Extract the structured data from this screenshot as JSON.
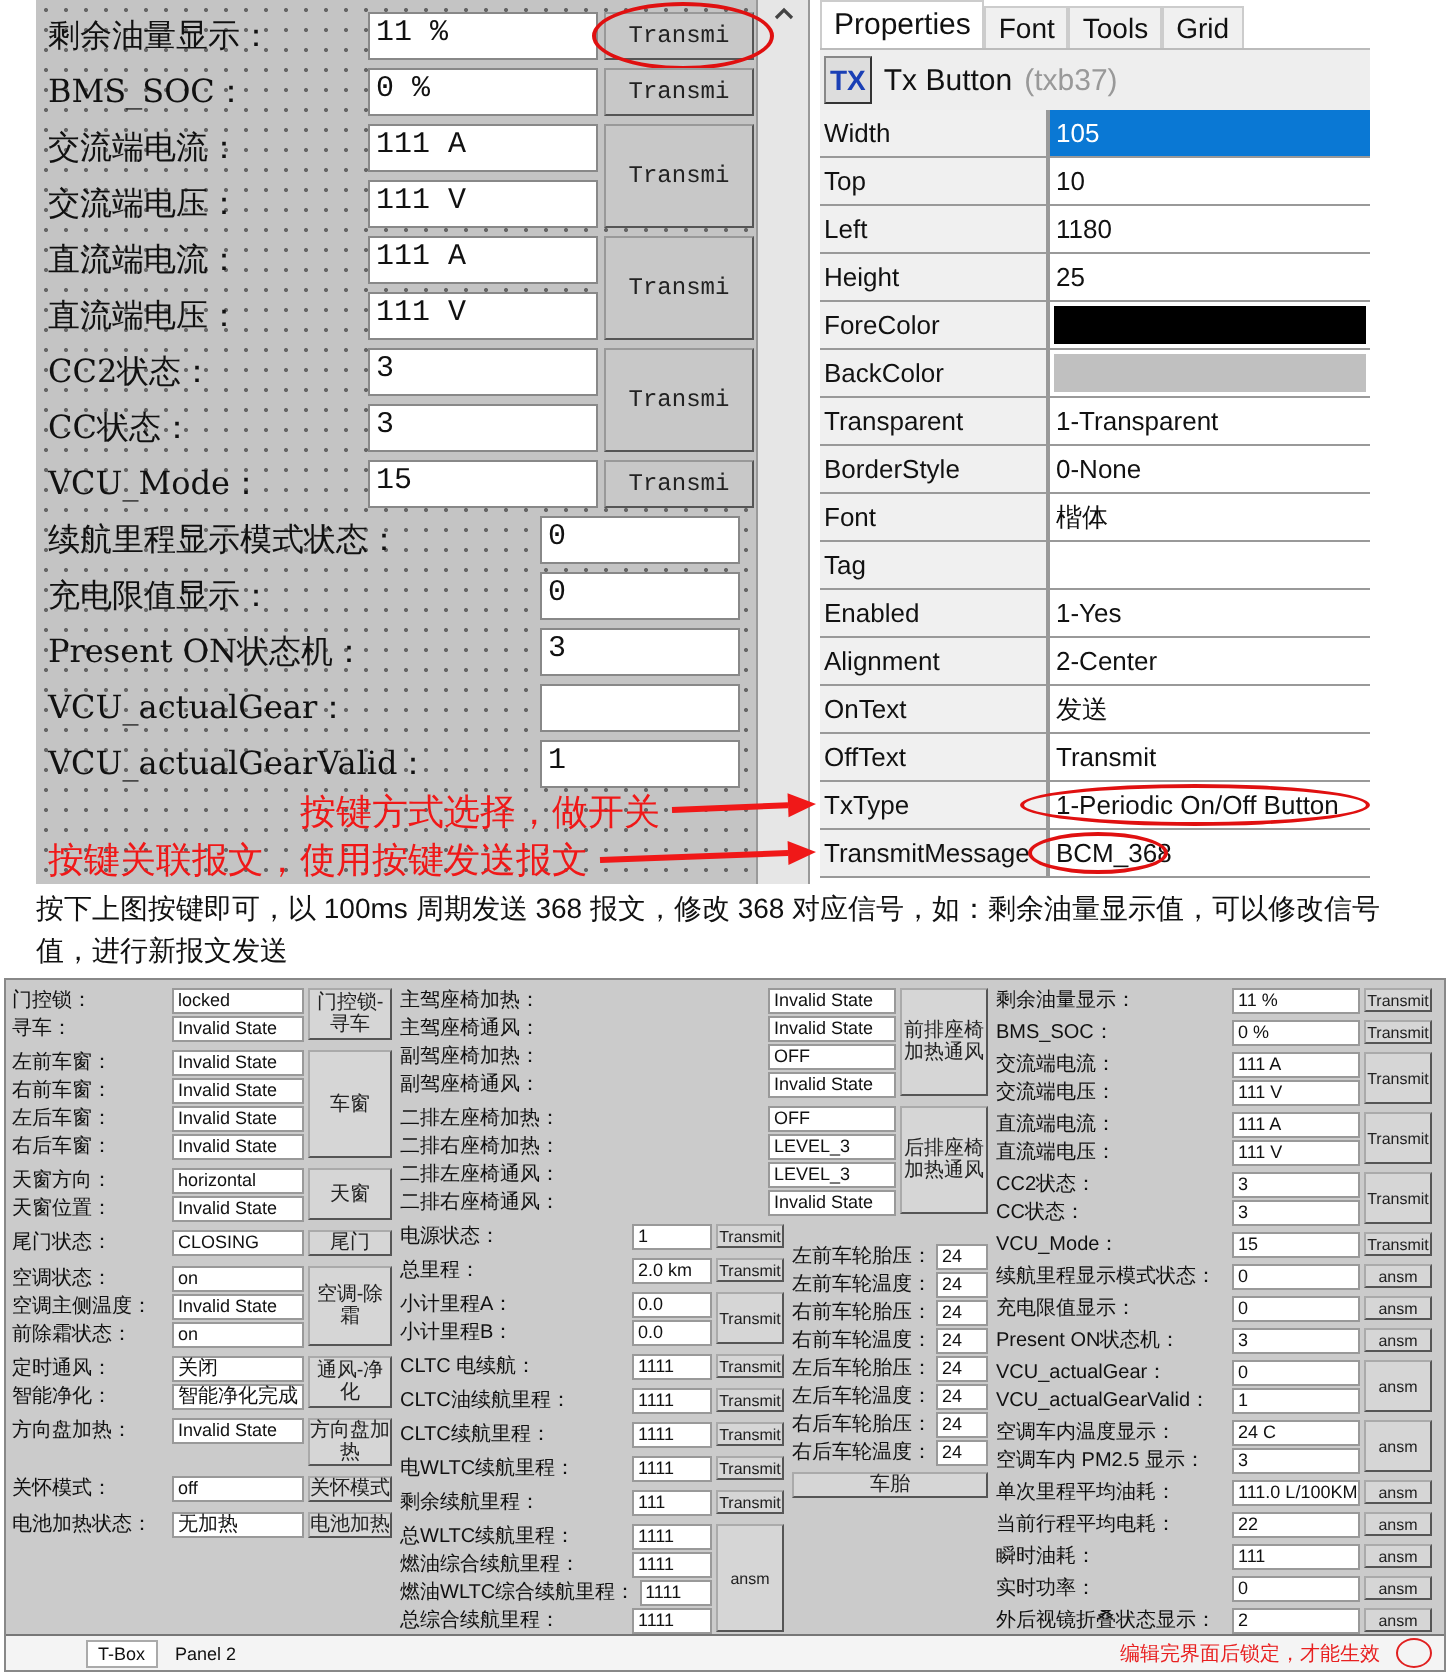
{
  "canvas": {
    "groups": [
      {
        "kind": "button_group",
        "fields": [
          {
            "label": "剩余油量显示：",
            "value": "11 %"
          }
        ],
        "button": "Transmi",
        "circled": true
      },
      {
        "kind": "button_group",
        "fields": [
          {
            "label": "BMS_SOC：",
            "value": "0 %"
          }
        ],
        "button": "Transmi",
        "circled": false
      },
      {
        "kind": "button_group",
        "fields": [
          {
            "label": "交流端电流：",
            "value": "111 A"
          },
          {
            "label": "交流端电压：",
            "value": "111 V"
          }
        ],
        "button": "Transmi",
        "circled": false
      },
      {
        "kind": "button_group",
        "fields": [
          {
            "label": "直流端电流：",
            "value": "111 A"
          },
          {
            "label": "直流端电压：",
            "value": "111 V"
          }
        ],
        "button": "Transmi",
        "circled": false
      },
      {
        "kind": "button_group",
        "fields": [
          {
            "label": "CC2状态：",
            "value": "3"
          },
          {
            "label": "CC状态：",
            "value": "3"
          }
        ],
        "button": "Transmi",
        "circled": false
      },
      {
        "kind": "button_group",
        "fields": [
          {
            "label": "VCU_Mode：",
            "value": "15"
          }
        ],
        "button": "Transmi",
        "circled": false
      },
      {
        "kind": "plain",
        "fields": [
          {
            "label": "续航里程显示模式状态：",
            "value": "0"
          },
          {
            "label": "充电限值显示：",
            "value": "0"
          },
          {
            "label": "Present ON状态机：",
            "value": "3"
          },
          {
            "label": "VCU_actualGear："
          },
          {
            "label": "VCU_actualGearValid：",
            "value": "1"
          }
        ]
      }
    ]
  },
  "annotations": [
    {
      "text": "按键方式选择，做开关"
    },
    {
      "text": "按键关联报文，使用按键发送报文"
    }
  ],
  "properties": {
    "tabs": [
      {
        "label": "Properties",
        "selected": true
      },
      {
        "label": "Font",
        "selected": false
      },
      {
        "label": "Tools",
        "selected": false
      },
      {
        "label": "Grid",
        "selected": false
      }
    ],
    "header": {
      "icon_text": "TX",
      "title": "Tx Button",
      "id": "(txb37)"
    },
    "rows": [
      {
        "kind": "text",
        "name": "Width",
        "value": "105",
        "selected": true,
        "circled": false
      },
      {
        "kind": "text",
        "name": "Top",
        "value": "10",
        "selected": false,
        "circled": false
      },
      {
        "kind": "text",
        "name": "Left",
        "value": "1180",
        "selected": false,
        "circled": false
      },
      {
        "kind": "text",
        "name": "Height",
        "value": "25",
        "selected": false,
        "circled": false
      },
      {
        "kind": "color",
        "name": "ForeColor",
        "color": "#000000",
        "selected": false,
        "circled": false
      },
      {
        "kind": "color",
        "name": "BackColor",
        "color": "#c0c0c0",
        "selected": false,
        "circled": false
      },
      {
        "kind": "text",
        "name": "Transparent",
        "value": "1-Transparent",
        "selected": false,
        "circled": false
      },
      {
        "kind": "text",
        "name": "BorderStyle",
        "value": "0-None",
        "selected": false,
        "circled": false
      },
      {
        "kind": "text",
        "name": "Font",
        "value": "楷体",
        "selected": false,
        "circled": false
      },
      {
        "kind": "text",
        "name": "Tag",
        "selected": false,
        "circled": false
      },
      {
        "kind": "text",
        "name": "Enabled",
        "value": "1-Yes",
        "selected": false,
        "circled": false
      },
      {
        "kind": "text",
        "name": "Alignment",
        "value": "2-Center",
        "selected": false,
        "circled": false
      },
      {
        "kind": "text",
        "name": "OnText",
        "value": "发送",
        "selected": false,
        "circled": false
      },
      {
        "kind": "text",
        "name": "OffText",
        "value": "Transmit",
        "selected": false,
        "circled": false
      },
      {
        "kind": "text",
        "name": "TxType",
        "value": "1-Periodic On/Off Button",
        "selected": false,
        "circled": true
      },
      {
        "kind": "text",
        "name": "TransmitMessage",
        "value": "BCM_368",
        "selected": false,
        "circled": true
      }
    ]
  },
  "paragraph": "按下上图按键即可，以 100ms 周期发送 368 报文，修改 368 对应信号，如：剩余油量显示值，可以修改信号值，进行新报文发送",
  "app_panel": {
    "left_groups": [
      {
        "kind": "side",
        "fields": [
          {
            "label": "门控锁：",
            "value": "locked"
          },
          {
            "label": "寻车：",
            "value": "Invalid State"
          }
        ],
        "button": "门控锁-寻车"
      },
      {
        "kind": "side",
        "fields": [
          {
            "label": "左前车窗：",
            "value": "Invalid State"
          },
          {
            "label": "右前车窗：",
            "value": "Invalid State"
          },
          {
            "label": "左后车窗：",
            "value": "Invalid State"
          },
          {
            "label": "右后车窗：",
            "value": "Invalid State"
          }
        ],
        "button": "车窗"
      },
      {
        "kind": "side",
        "fields": [
          {
            "label": "天窗方向：",
            "value": "horizontal"
          },
          {
            "label": "天窗位置：",
            "value": "Invalid State"
          }
        ],
        "button": "天窗"
      },
      {
        "kind": "side",
        "fields": [
          {
            "label": "尾门状态：",
            "value": "CLOSING"
          }
        ],
        "button": "尾门"
      },
      {
        "kind": "side",
        "fields": [
          {
            "label": "空调状态：",
            "value": "on"
          },
          {
            "label": "空调主侧温度：",
            "value": "Invalid State"
          },
          {
            "label": "前除霜状态：",
            "value": "on"
          }
        ],
        "button": "空调-除霜"
      },
      {
        "kind": "side",
        "fields": [
          {
            "label": "定时通风：",
            "value": "关闭"
          },
          {
            "label": "智能净化：",
            "value": "智能净化完成"
          }
        ],
        "button": "通风-净化"
      },
      {
        "kind": "side",
        "fields": [
          {
            "label": "方向盘加热：",
            "value": "Invalid State"
          }
        ],
        "button": "方向盘加热"
      },
      {
        "kind": "side",
        "fields": [
          {
            "label": "关怀模式：",
            "value": "off"
          }
        ],
        "button": "关怀模式"
      },
      {
        "kind": "side",
        "fields": [
          {
            "label": "电池加热状态：",
            "value": "无加热"
          }
        ],
        "button": "电池加热"
      }
    ],
    "seat_groups": [
      {
        "kind": "side",
        "fields": [
          {
            "label": "主驾座椅加热：",
            "value": "Invalid State"
          },
          {
            "label": "主驾座椅通风：",
            "value": "Invalid State"
          },
          {
            "label": "副驾座椅加热：",
            "value": "OFF"
          },
          {
            "label": "副驾座椅通风：",
            "value": "Invalid State"
          }
        ],
        "button": "前排座椅加热通风"
      },
      {
        "kind": "side",
        "fields": [
          {
            "label": "二排左座椅加热：",
            "value": "OFF"
          },
          {
            "label": "二排右座椅加热：",
            "value": "LEVEL_3"
          },
          {
            "label": "二排左座椅通风：",
            "value": "LEVEL_3"
          },
          {
            "label": "二排右座椅通风：",
            "value": "Invalid State"
          }
        ],
        "button": "后排座椅加热通风"
      }
    ],
    "value_groups": [
      {
        "kind": "side",
        "fields": [
          {
            "label": "电源状态：",
            "value": "1"
          }
        ],
        "button": "Transmit"
      },
      {
        "kind": "side",
        "fields": [
          {
            "label": "总里程：",
            "value": "2.0 km"
          }
        ],
        "button": "Transmit"
      },
      {
        "kind": "side",
        "fields": [
          {
            "label": "小计里程A：",
            "value": "0.0"
          },
          {
            "label": "小计里程B：",
            "value": "0.0"
          }
        ],
        "button": "Transmit"
      },
      {
        "kind": "side",
        "fields": [
          {
            "label": "CLTC 电续航：",
            "value": "1111"
          }
        ],
        "button": "Transmit"
      },
      {
        "kind": "side",
        "fields": [
          {
            "label": "CLTC油续航里程：",
            "value": "1111"
          }
        ],
        "button": "Transmit"
      },
      {
        "kind": "side",
        "fields": [
          {
            "label": "CLTC续航里程：",
            "value": "1111"
          }
        ],
        "button": "Transmit"
      },
      {
        "kind": "side",
        "fields": [
          {
            "label": "电WLTC续航里程：",
            "value": "1111"
          }
        ],
        "button": "Transmit"
      },
      {
        "kind": "side",
        "fields": [
          {
            "label": "剩余续航里程：",
            "value": "111"
          }
        ],
        "button": "Transmit"
      },
      {
        "kind": "side",
        "fields": [
          {
            "label": "总WLTC续航里程：",
            "value": "1111"
          },
          {
            "label": "燃油综合续航里程：",
            "value": "1111"
          },
          {
            "label": "燃油WLTC综合续航里程：",
            "value": "1111"
          },
          {
            "label": "总综合续航里程：",
            "value": "1111"
          }
        ],
        "button": "ansm"
      }
    ],
    "tire_group": {
      "kind": "stacked",
      "fields": [
        {
          "label": "左前车轮胎压：",
          "value": "24"
        },
        {
          "label": "左前车轮温度：",
          "value": "24"
        },
        {
          "label": "右前车轮胎压：",
          "value": "24"
        },
        {
          "label": "右前车轮温度：",
          "value": "24"
        },
        {
          "label": "左后车轮胎压：",
          "value": "24"
        },
        {
          "label": "左后车轮温度：",
          "value": "24"
        },
        {
          "label": "右后车轮胎压：",
          "value": "24"
        },
        {
          "label": "右后车轮温度：",
          "value": "24"
        }
      ],
      "button": "车胎"
    },
    "right_groups": [
      {
        "kind": "side",
        "fields": [
          {
            "label": "剩余油量显示：",
            "value": "11 %"
          }
        ],
        "button": "Transmit"
      },
      {
        "kind": "side",
        "fields": [
          {
            "label": "BMS_SOC：",
            "value": "0 %"
          }
        ],
        "button": "Transmit"
      },
      {
        "kind": "side",
        "fields": [
          {
            "label": "交流端电流：",
            "value": "111 A"
          },
          {
            "label": "交流端电压：",
            "value": "111 V"
          }
        ],
        "button": "Transmit"
      },
      {
        "kind": "side",
        "fields": [
          {
            "label": "直流端电流：",
            "value": "111 A"
          },
          {
            "label": "直流端电压：",
            "value": "111 V"
          }
        ],
        "button": "Transmit"
      },
      {
        "kind": "side",
        "fields": [
          {
            "label": "CC2状态：",
            "value": "3"
          },
          {
            "label": "CC状态：",
            "value": "3"
          }
        ],
        "button": "Transmit"
      },
      {
        "kind": "side",
        "fields": [
          {
            "label": "VCU_Mode：",
            "value": "15"
          }
        ],
        "button": "Transmit"
      },
      {
        "kind": "side",
        "fields": [
          {
            "label": "续航里程显示模式状态：",
            "value": "0"
          }
        ],
        "button": "ansm"
      },
      {
        "kind": "side",
        "fields": [
          {
            "label": "充电限值显示：",
            "value": "0"
          }
        ],
        "button": "ansm"
      },
      {
        "kind": "side",
        "fields": [
          {
            "label": "Present ON状态机：",
            "value": "3"
          }
        ],
        "button": "ansm"
      },
      {
        "kind": "side",
        "fields": [
          {
            "label": "VCU_actualGear：",
            "value": "0"
          },
          {
            "label": "VCU_actualGearValid：",
            "value": "1"
          }
        ],
        "button": "ansm"
      },
      {
        "kind": "side",
        "fields": [
          {
            "label": "空调车内温度显示：",
            "value": "24 C"
          },
          {
            "label": "空调车内 PM2.5 显示：",
            "value": "3"
          }
        ],
        "button": "ansm"
      },
      {
        "kind": "side",
        "fields": [
          {
            "label": "单次里程平均油耗：",
            "value": "111.0 L/100KM"
          }
        ],
        "button": "ansm"
      },
      {
        "kind": "side",
        "fields": [
          {
            "label": "当前行程平均电耗：",
            "value": "22"
          }
        ],
        "button": "ansm"
      },
      {
        "kind": "side",
        "fields": [
          {
            "label": "瞬时油耗：",
            "value": "111"
          }
        ],
        "button": "ansm"
      },
      {
        "kind": "side",
        "fields": [
          {
            "label": "实时功率：",
            "value": "0"
          }
        ],
        "button": "ansm"
      },
      {
        "kind": "side",
        "fields": [
          {
            "label": "外后视镜折叠状态显示：",
            "value": "2"
          }
        ],
        "button": "ansm"
      }
    ],
    "tabs": [
      {
        "label": "T-Box",
        "selected": true
      },
      {
        "label": "Panel 2",
        "selected": false
      }
    ],
    "note": "编辑完界面后锁定，才能生效"
  }
}
